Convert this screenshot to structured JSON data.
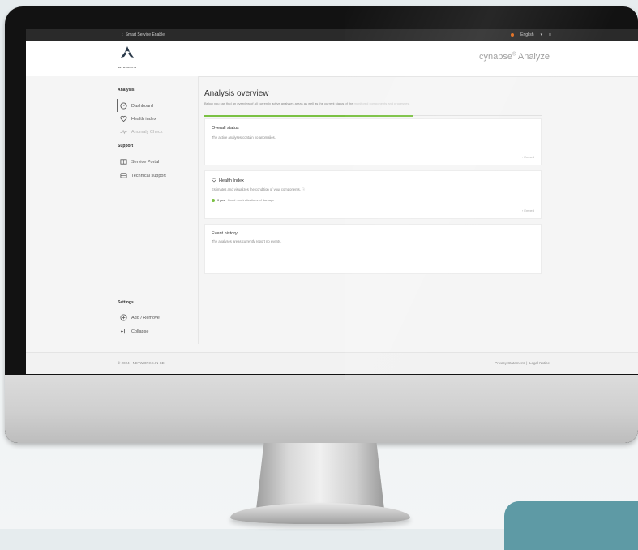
{
  "topbar": {
    "back_label": "Smart Service Enable",
    "language_label": "English"
  },
  "header": {
    "logo_text": "NETWORKS.IN",
    "product_name": "cynapse",
    "product_suffix": "Analyze"
  },
  "sidebar": {
    "section_analysis": "Analysis",
    "items_analysis": [
      {
        "label": "Dashboard",
        "icon": "dashboard-icon",
        "active": true
      },
      {
        "label": "Health index",
        "icon": "health-index-icon",
        "active": false
      },
      {
        "label": "Anomaly Check",
        "icon": "anomaly-icon",
        "active": false
      }
    ],
    "section_support": "Support",
    "items_support": [
      {
        "label": "Service Portal",
        "icon": "service-portal-icon"
      },
      {
        "label": "Technical support",
        "icon": "technical-support-icon"
      }
    ],
    "section_settings": "Settings",
    "items_settings": [
      {
        "label": "Add / Remove",
        "icon": "add-remove-icon"
      },
      {
        "label": "Collapse",
        "icon": "collapse-icon"
      }
    ]
  },
  "main": {
    "title": "Analysis overview",
    "description": "Below you can find an overview of all currently active analyses areas as well as the current status of the",
    "description_muted": "monitored components and processes.",
    "progress": 0.62,
    "cards": {
      "overall": {
        "title": "Overall status",
        "text": "The active analyses contain no anomalies.",
        "expand": "Embed"
      },
      "health": {
        "title": "Health Index",
        "text": "Estimates and visualizes the condition of your components.",
        "status_ok": "0 pcs",
        "status_text": "Good - no indications of damage",
        "expand": "Embed"
      },
      "events": {
        "title": "Event history",
        "text": "The analyses areas currently report no events."
      }
    }
  },
  "footer": {
    "copyright": "© 2024 · NETWORKS.IN SE",
    "privacy": "Privacy Statement",
    "separator": "|",
    "legal": "Legal Notice"
  },
  "colors": {
    "accent_green": "#7ac143",
    "topbar": "#2a2a2a",
    "teal_badge": "#5e9aa5"
  }
}
